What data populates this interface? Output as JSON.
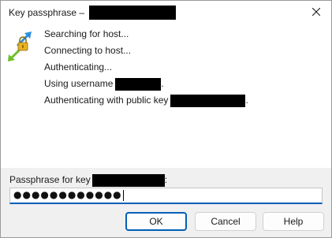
{
  "window": {
    "title": "Key passphrase –"
  },
  "log": {
    "lines": [
      {
        "text": "Searching for host..."
      },
      {
        "text": "Connecting to host..."
      },
      {
        "text": "Authenticating..."
      },
      {
        "text": "Using username",
        "suffix": "."
      },
      {
        "text": "Authenticating with public key",
        "suffix": "."
      }
    ]
  },
  "prompt": {
    "label": "Passphrase for key",
    "value": "●●●●●●●●●●●●"
  },
  "buttons": {
    "ok": "OK",
    "cancel": "Cancel",
    "help": "Help"
  },
  "colors": {
    "accent": "#005fb8",
    "icon_blue": "#2f8fdc",
    "icon_green": "#6cbf2a",
    "icon_gold": "#e9b224"
  },
  "icons": {
    "app": "key-transfer-icon",
    "close": "close-icon"
  }
}
